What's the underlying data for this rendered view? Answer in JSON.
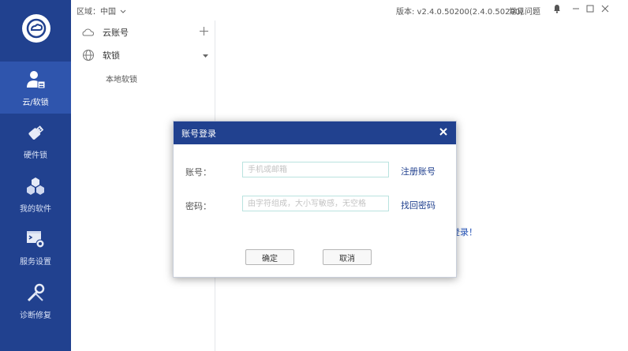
{
  "nav": {
    "items": [
      {
        "label": "云/软锁",
        "icon": "user-lock-icon",
        "active": true
      },
      {
        "label": "硬件锁",
        "icon": "usb-key-icon",
        "active": false
      },
      {
        "label": "我的软件",
        "icon": "cubes-icon",
        "active": false
      },
      {
        "label": "服务设置",
        "icon": "terminal-gear-icon",
        "active": false
      },
      {
        "label": "诊断修复",
        "icon": "wrench-screwdriver-icon",
        "active": false
      }
    ]
  },
  "topbar": {
    "region": "区域：中国",
    "version": "版本: v2.4.0.50200(2.4.0.50200)",
    "faq": "常见问题"
  },
  "sidebar": {
    "cloud_account": "云账号",
    "soft_lock": "软锁",
    "local_soft_lock": "本地软锁"
  },
  "background": {
    "login_link_fragment": "登录！"
  },
  "dialog": {
    "title": "账号登录",
    "account_label": "账号：",
    "account_placeholder": "手机或邮箱",
    "register_link": "注册账号",
    "password_label": "密码：",
    "password_placeholder": "由字符组成，大小写敏感，无空格",
    "recover_link": "找回密码",
    "confirm": "确定",
    "cancel": "取消"
  },
  "colors": {
    "nav_bg": "#21418f",
    "nav_active": "#2f55ad",
    "link": "#21418f"
  }
}
